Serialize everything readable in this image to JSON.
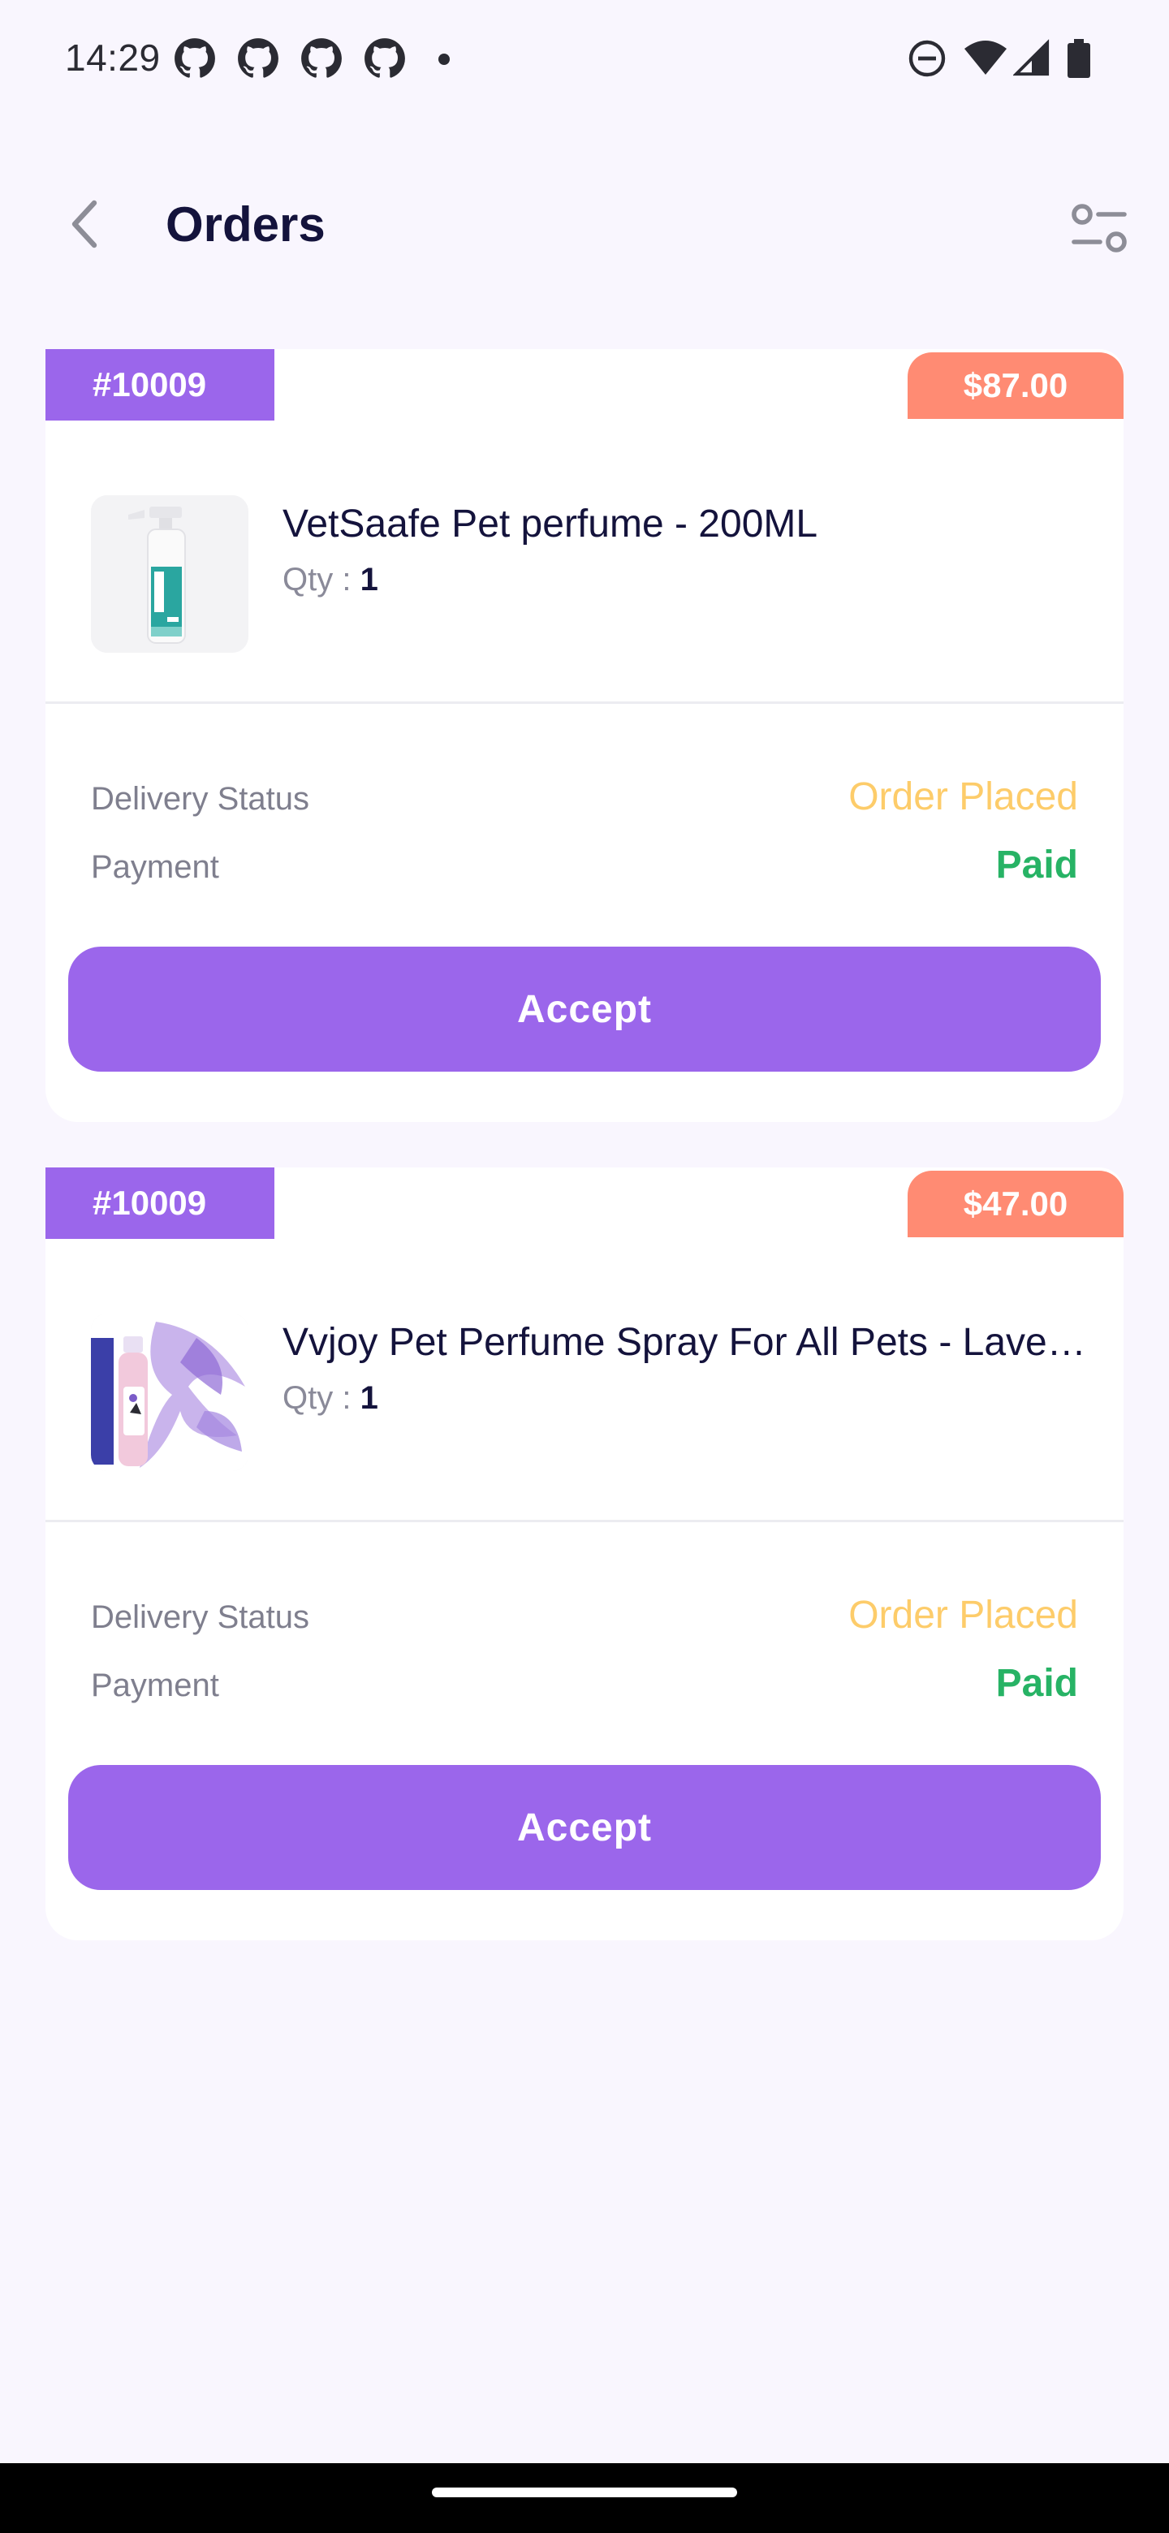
{
  "status_bar": {
    "time": "14:29",
    "notification_icons": [
      "github-icon",
      "github-icon",
      "github-icon",
      "github-icon",
      "dot-icon"
    ],
    "system_icons": [
      "do-not-disturb-icon",
      "wifi-icon",
      "signal-icon",
      "battery-icon"
    ]
  },
  "header": {
    "title": "Orders",
    "back_icon": "chevron-left-icon",
    "filter_icon": "filter-sliders-icon"
  },
  "orders": [
    {
      "order_id": "#10009",
      "total": "$87.00",
      "product_name": "VetSaafe Pet perfume - 200ML",
      "qty_label": "Qty : ",
      "qty": "1",
      "delivery_status_label": "Delivery Status",
      "delivery_status": "Order Placed",
      "payment_label": "Payment",
      "payment_status": "Paid",
      "action_label": "Accept"
    },
    {
      "order_id": "#10009",
      "total": "$47.00",
      "product_name": "Vvjoy Pet Perfume Spray For All Pets - Lavender",
      "qty_label": "Qty : ",
      "qty": "1",
      "delivery_status_label": "Delivery Status",
      "delivery_status": "Order Placed",
      "payment_label": "Payment",
      "payment_status": "Paid",
      "action_label": "Accept"
    }
  ],
  "colors": {
    "accent": "#9b66eb",
    "price_badge": "#ff8b73",
    "order_placed": "#fdcc6a",
    "paid": "#27b365",
    "background": "#f9f6fe"
  }
}
